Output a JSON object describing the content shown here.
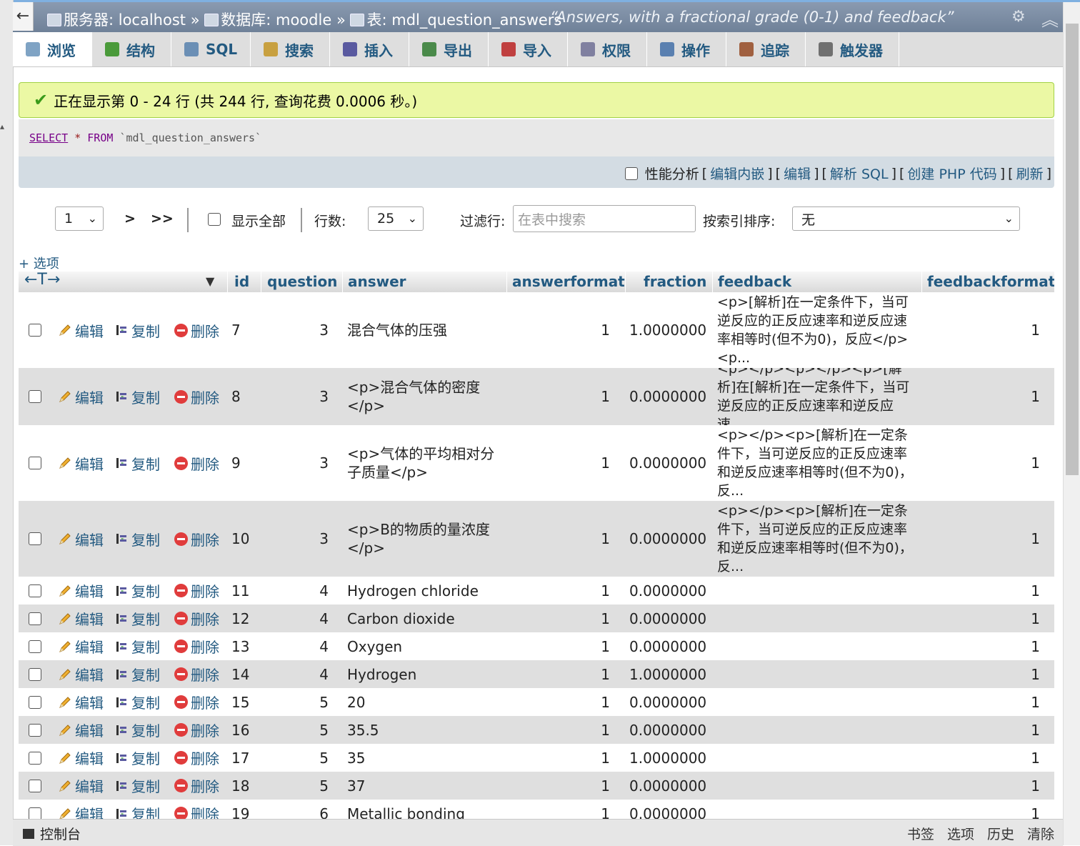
{
  "topbar": {
    "back": "←",
    "crumb_server": "服务器: localhost",
    "crumb_db": "数据库: moodle",
    "crumb_table": "表: mdl_question_answers",
    "sep": "»",
    "table_comment": "“Answers, with a fractional grade (0-1) and feedback”"
  },
  "tabs": [
    {
      "label": "浏览",
      "icon": "browse-icon",
      "color": "#7fa3c4"
    },
    {
      "label": "结构",
      "icon": "structure-icon",
      "color": "#4a9a3a"
    },
    {
      "label": "SQL",
      "icon": "sql-icon",
      "color": "#6b8fb5"
    },
    {
      "label": "搜索",
      "icon": "search-icon",
      "color": "#c8a040"
    },
    {
      "label": "插入",
      "icon": "insert-icon",
      "color": "#5a5aa0"
    },
    {
      "label": "导出",
      "icon": "export-icon",
      "color": "#4a8a4a"
    },
    {
      "label": "导入",
      "icon": "import-icon",
      "color": "#c04040"
    },
    {
      "label": "权限",
      "icon": "privileges-icon",
      "color": "#8080a0"
    },
    {
      "label": "操作",
      "icon": "operations-icon",
      "color": "#5a80b0"
    },
    {
      "label": "追踪",
      "icon": "tracking-icon",
      "color": "#a06040"
    },
    {
      "label": "触发器",
      "icon": "triggers-icon",
      "color": "#707070"
    }
  ],
  "success_message": "正在显示第 0 - 24 行 (共 244 行, 查询花费 0.0006 秒。)",
  "sql": {
    "select": "SELECT",
    "star": "*",
    "from": "FROM",
    "table": "`mdl_question_answers`"
  },
  "toolbar": {
    "profiling": "性能分析",
    "edit_inline": "编辑内嵌",
    "edit": "编辑",
    "explain": "解析 SQL",
    "php": "创建 PHP 代码",
    "refresh": "刷新"
  },
  "nav": {
    "page": "1",
    "next": ">",
    "last": ">>",
    "show_all": "显示全部",
    "rows_label": "行数:",
    "rows_value": "25",
    "filter_label": "过滤行:",
    "filter_placeholder": "在表中搜索",
    "sort_label": "按索引排序:",
    "sort_value": "无"
  },
  "options_link": "+ 选项",
  "columns": {
    "arrows": "←T→",
    "id": "id",
    "question": "question",
    "answer": "answer",
    "answerformat": "answerformat",
    "fraction": "fraction",
    "feedback": "feedback",
    "feedbackformat": "feedbackformat"
  },
  "row_actions": {
    "edit": "编辑",
    "copy": "复制",
    "delete": "删除"
  },
  "rows": [
    {
      "id": "7",
      "question": "3",
      "answer": "混合气体的压强",
      "answerformat": "1",
      "fraction": "1.0000000",
      "feedback": "<p>[解析]在一定条件下，当可逆反应的正反应速率和逆反应速率相等时(但不为0)，反应</p><p...",
      "feedbackformat": "1"
    },
    {
      "id": "8",
      "question": "3",
      "answer": "<p>混合气体的密度</p>",
      "answerformat": "1",
      "fraction": "0.0000000",
      "feedback": "<p></p><p></p><p>[解析]在[解析]在一定条件下，当可逆反应的正反应速率和逆反应速...",
      "feedbackformat": "1"
    },
    {
      "id": "9",
      "question": "3",
      "answer": "<p>气体的平均相对分子质量</p>",
      "answerformat": "1",
      "fraction": "0.0000000",
      "feedback": "<p></p><p>[解析]在一定条件下，当可逆反应的正反应速率和逆反应速率相等时(但不为0)，反...",
      "feedbackformat": "1"
    },
    {
      "id": "10",
      "question": "3",
      "answer": "<p>B的物质的量浓度</p>",
      "answerformat": "1",
      "fraction": "0.0000000",
      "feedback": "<p></p><p>[解析]在一定条件下，当可逆反应的正反应速率和逆反应速率相等时(但不为0)，反...",
      "feedbackformat": "1"
    },
    {
      "id": "11",
      "question": "4",
      "answer": "Hydrogen chloride",
      "answerformat": "1",
      "fraction": "0.0000000",
      "feedback": "",
      "feedbackformat": "1"
    },
    {
      "id": "12",
      "question": "4",
      "answer": "Carbon dioxide",
      "answerformat": "1",
      "fraction": "0.0000000",
      "feedback": "",
      "feedbackformat": "1"
    },
    {
      "id": "13",
      "question": "4",
      "answer": "Oxygen",
      "answerformat": "1",
      "fraction": "0.0000000",
      "feedback": "",
      "feedbackformat": "1"
    },
    {
      "id": "14",
      "question": "4",
      "answer": "Hydrogen",
      "answerformat": "1",
      "fraction": "1.0000000",
      "feedback": "",
      "feedbackformat": "1"
    },
    {
      "id": "15",
      "question": "5",
      "answer": "20",
      "answerformat": "1",
      "fraction": "0.0000000",
      "feedback": "",
      "feedbackformat": "1"
    },
    {
      "id": "16",
      "question": "5",
      "answer": "35.5",
      "answerformat": "1",
      "fraction": "0.0000000",
      "feedback": "",
      "feedbackformat": "1"
    },
    {
      "id": "17",
      "question": "5",
      "answer": "35",
      "answerformat": "1",
      "fraction": "1.0000000",
      "feedback": "",
      "feedbackformat": "1"
    },
    {
      "id": "18",
      "question": "5",
      "answer": "37",
      "answerformat": "1",
      "fraction": "0.0000000",
      "feedback": "",
      "feedbackformat": "1"
    },
    {
      "id": "19",
      "question": "6",
      "answer": "Metallic bonding",
      "answerformat": "1",
      "fraction": "0.0000000",
      "feedback": "",
      "feedbackformat": "1"
    }
  ],
  "bottombar": {
    "console": "控制台",
    "bookmarks": "书签",
    "options": "选项",
    "history": "历史",
    "clear": "清除"
  }
}
